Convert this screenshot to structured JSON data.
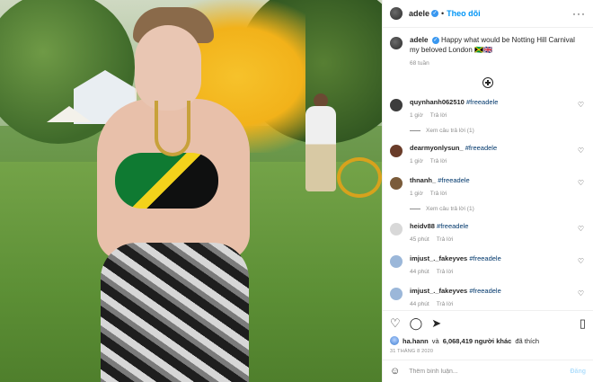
{
  "header": {
    "username": "adele",
    "separator": "•",
    "follow_label": "Theo dõi",
    "more_icon": "more-icon"
  },
  "caption": {
    "username": "adele",
    "text": "Happy what would be Notting Hill Carnival my beloved London 🇯🇲🇬🇧",
    "time": "68 tuần"
  },
  "comments": [
    {
      "username": "quynhanh062510",
      "text": "#freeadele",
      "time": "1 giờ",
      "reply_label": "Trả lời",
      "replies": "Xem câu trả lời (1)",
      "avatar_color": "#3c3c3c"
    },
    {
      "username": "dearmyonlysun_",
      "text": "#freeadele",
      "time": "1 giờ",
      "reply_label": "Trả lời",
      "replies": "",
      "avatar_color": "#6a3d2a"
    },
    {
      "username": "thnanh_",
      "text": "#freeadele",
      "time": "1 giờ",
      "reply_label": "Trả lời",
      "replies": "Xem câu trả lời (1)",
      "avatar_color": "#7a5b3a"
    },
    {
      "username": "heidv88",
      "text": "#freeadele",
      "time": "45 phút",
      "reply_label": "Trả lời",
      "replies": "",
      "avatar_color": "#d8d8d8"
    },
    {
      "username": "imjust_._fakeyves",
      "text": "#freeadele",
      "time": "44 phút",
      "reply_label": "Trả lời",
      "replies": "",
      "avatar_color": "#9bb7d9"
    },
    {
      "username": "imjust_._fakeyves",
      "text": "#freeadele",
      "time": "44 phút",
      "reply_label": "Trả lời",
      "replies": "",
      "avatar_color": "#9bb7d9"
    }
  ],
  "likes": {
    "user": "ha.hann",
    "connector": "và",
    "count": "6,068,419 người khác",
    "suffix": "đã thích"
  },
  "date": "31 tháng 8 2020",
  "add_comment": {
    "placeholder": "Thêm bình luận...",
    "post_label": "Đăng"
  }
}
